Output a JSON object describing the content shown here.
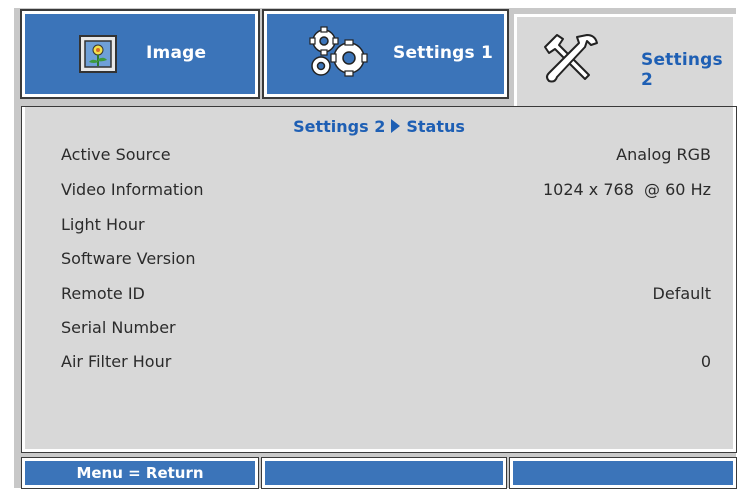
{
  "tabs": [
    {
      "label": "Image",
      "icon": "image-icon",
      "active": false
    },
    {
      "label": "Settings 1",
      "icon": "gears-icon",
      "active": false
    },
    {
      "label": "Settings 2",
      "icon": "tools-icon",
      "active": true
    }
  ],
  "breadcrumb": {
    "parent": "Settings 2",
    "current": "Status"
  },
  "status_rows": [
    {
      "name": "Active Source",
      "value": "Analog RGB"
    },
    {
      "name": "Video Information",
      "value": "1024 x 768  @ 60 Hz"
    },
    {
      "name": "Light Hour",
      "value": ""
    },
    {
      "name": "Software Version",
      "value": ""
    },
    {
      "name": "Remote ID",
      "value": "Default"
    },
    {
      "name": "Serial Number",
      "value": ""
    },
    {
      "name": "Air Filter Hour",
      "value": "0"
    }
  ],
  "footer": {
    "hint": "Menu = Return",
    "slot2": "",
    "slot3": ""
  },
  "colors": {
    "tab_blue": "#3b74b9",
    "active_text": "#1e5fb4",
    "panel": "#d8d8d8",
    "frame": "#c8c8c8"
  }
}
